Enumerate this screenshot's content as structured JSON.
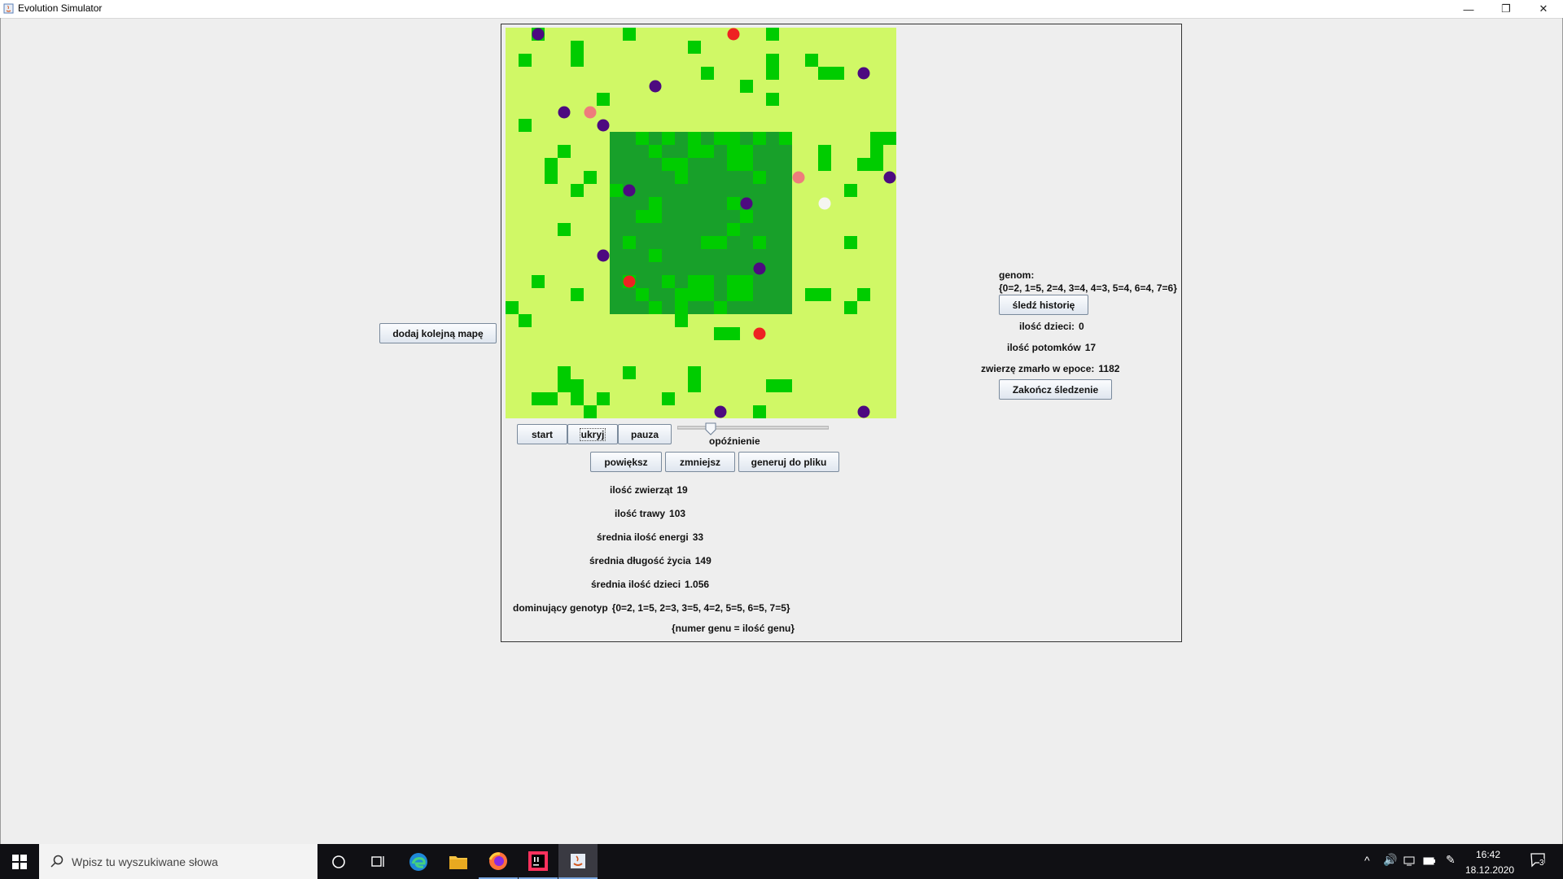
{
  "window": {
    "title": "Evolution Simulator",
    "controls": [
      "—",
      "❐",
      "✕"
    ]
  },
  "sidebar": {
    "add_map_label": "dodaj kolejną mapę"
  },
  "controls": {
    "start_label": "start",
    "hide_label": "ukryj",
    "pause_label": "pauza",
    "delay_label": "opóźnienie",
    "delay_value": 0.2,
    "zoom_in_label": "powiększ",
    "zoom_out_label": "zmniejsz",
    "export_label": "generuj do pliku"
  },
  "stats": [
    {
      "label": "ilość zwierząt",
      "value": "19"
    },
    {
      "label": "ilość trawy",
      "value": "103"
    },
    {
      "label": "średnia ilość energi",
      "value": "33"
    },
    {
      "label": "średnia długość życia",
      "value": "149"
    },
    {
      "label": "średnia ilość dzieci",
      "value": "1.056"
    },
    {
      "label": "dominujący genotyp",
      "value": "{0=2, 1=5, 2=3, 3=5, 4=2, 5=5, 6=5, 7=5}"
    }
  ],
  "genotype_note": "{numer genu = ilość genu}",
  "tracking": {
    "genome_label": "genom:",
    "genome_value": "{0=2, 1=5, 2=4, 3=4, 4=3, 5=4, 6=4, 7=6}",
    "track_history_label": "śledź historię",
    "children": {
      "label": "ilość dzieci:",
      "value": "0"
    },
    "descendants": {
      "label": "ilość potomków",
      "value": "17"
    },
    "died": {
      "label": "zwierzę zmarło w epoce:",
      "value": "1182"
    },
    "end_tracking_label": "Zakończ śledzenie"
  },
  "map": {
    "colors": {
      "steppe": "#d0f866",
      "jungle": "#18a02a",
      "grass": "#00cc00",
      "animal": "#4d0a80",
      "animal_strong": "#ee2222",
      "animal_mid": "#ee7c7c",
      "animal_weak": "#f5f5f0"
    },
    "jungle_cells": {
      "cols": [
        8,
        21
      ],
      "rows": [
        8,
        21
      ]
    },
    "grass": [
      [
        2,
        0
      ],
      [
        9,
        0
      ],
      [
        20,
        0
      ],
      [
        5,
        1
      ],
      [
        14,
        1
      ],
      [
        1,
        2
      ],
      [
        5,
        2
      ],
      [
        20,
        2
      ],
      [
        23,
        2
      ],
      [
        15,
        3
      ],
      [
        20,
        3
      ],
      [
        24,
        3
      ],
      [
        25,
        3
      ],
      [
        18,
        4
      ],
      [
        7,
        5
      ],
      [
        20,
        5
      ],
      [
        1,
        7
      ],
      [
        10,
        8
      ],
      [
        12,
        8
      ],
      [
        14,
        8
      ],
      [
        16,
        8
      ],
      [
        17,
        8
      ],
      [
        19,
        8
      ],
      [
        21,
        8
      ],
      [
        28,
        8
      ],
      [
        29,
        8
      ],
      [
        4,
        9
      ],
      [
        11,
        9
      ],
      [
        14,
        9
      ],
      [
        15,
        9
      ],
      [
        17,
        9
      ],
      [
        18,
        9
      ],
      [
        24,
        9
      ],
      [
        28,
        9
      ],
      [
        3,
        10
      ],
      [
        12,
        10
      ],
      [
        13,
        10
      ],
      [
        17,
        10
      ],
      [
        18,
        10
      ],
      [
        24,
        10
      ],
      [
        27,
        10
      ],
      [
        28,
        10
      ],
      [
        3,
        11
      ],
      [
        6,
        11
      ],
      [
        13,
        11
      ],
      [
        19,
        11
      ],
      [
        5,
        12
      ],
      [
        8,
        12
      ],
      [
        26,
        12
      ],
      [
        11,
        13
      ],
      [
        17,
        13
      ],
      [
        10,
        14
      ],
      [
        11,
        14
      ],
      [
        18,
        14
      ],
      [
        4,
        15
      ],
      [
        17,
        15
      ],
      [
        9,
        16
      ],
      [
        15,
        16
      ],
      [
        16,
        16
      ],
      [
        19,
        16
      ],
      [
        26,
        16
      ],
      [
        11,
        17
      ],
      [
        9,
        19
      ],
      [
        15,
        19
      ],
      [
        2,
        19
      ],
      [
        12,
        19
      ],
      [
        14,
        19
      ],
      [
        17,
        19
      ],
      [
        18,
        19
      ],
      [
        10,
        20
      ],
      [
        13,
        20
      ],
      [
        14,
        20
      ],
      [
        15,
        20
      ],
      [
        17,
        20
      ],
      [
        18,
        20
      ],
      [
        5,
        20
      ],
      [
        23,
        20
      ],
      [
        24,
        20
      ],
      [
        27,
        20
      ],
      [
        0,
        21
      ],
      [
        11,
        21
      ],
      [
        13,
        21
      ],
      [
        16,
        21
      ],
      [
        26,
        21
      ],
      [
        1,
        22
      ],
      [
        13,
        22
      ],
      [
        16,
        23
      ],
      [
        17,
        23
      ],
      [
        4,
        26
      ],
      [
        9,
        26
      ],
      [
        14,
        26
      ],
      [
        4,
        27
      ],
      [
        5,
        27
      ],
      [
        14,
        27
      ],
      [
        20,
        27
      ],
      [
        21,
        27
      ],
      [
        2,
        28
      ],
      [
        3,
        28
      ],
      [
        5,
        28
      ],
      [
        7,
        28
      ],
      [
        12,
        28
      ],
      [
        6,
        29
      ],
      [
        19,
        29
      ]
    ],
    "animals": [
      {
        "pos": [
          2,
          0
        ],
        "kind": "animal"
      },
      {
        "pos": [
          17,
          0
        ],
        "kind": "animal_strong"
      },
      {
        "pos": [
          27,
          3
        ],
        "kind": "animal"
      },
      {
        "pos": [
          11,
          4
        ],
        "kind": "animal"
      },
      {
        "pos": [
          4,
          6
        ],
        "kind": "animal"
      },
      {
        "pos": [
          6,
          6
        ],
        "kind": "animal_mid"
      },
      {
        "pos": [
          7,
          7
        ],
        "kind": "animal"
      },
      {
        "pos": [
          22,
          11
        ],
        "kind": "animal_mid"
      },
      {
        "pos": [
          29,
          11
        ],
        "kind": "animal"
      },
      {
        "pos": [
          9,
          12
        ],
        "kind": "animal"
      },
      {
        "pos": [
          18,
          13
        ],
        "kind": "animal"
      },
      {
        "pos": [
          24,
          13
        ],
        "kind": "animal_weak"
      },
      {
        "pos": [
          7,
          17
        ],
        "kind": "animal"
      },
      {
        "pos": [
          19,
          18
        ],
        "kind": "animal"
      },
      {
        "pos": [
          9,
          19
        ],
        "kind": "animal_strong"
      },
      {
        "pos": [
          19,
          23
        ],
        "kind": "animal_strong"
      },
      {
        "pos": [
          16,
          29
        ],
        "kind": "animal"
      },
      {
        "pos": [
          27,
          29
        ],
        "kind": "animal"
      }
    ]
  },
  "taskbar": {
    "search_placeholder": "Wpisz tu wyszukiwane słowa",
    "time": "16:42",
    "date": "18.12.2020",
    "notifications": "3"
  }
}
